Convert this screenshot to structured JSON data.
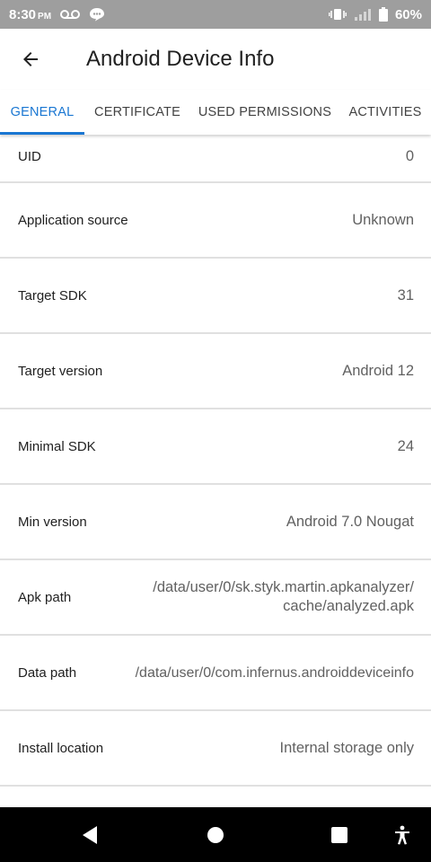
{
  "status_bar": {
    "time": "8:30",
    "ampm": "PM",
    "battery": "60%",
    "icons": [
      "voicemail-icon",
      "message-icon",
      "vibrate-icon",
      "signal-icon",
      "battery-icon"
    ]
  },
  "app_bar": {
    "title": "Android Device Info",
    "back_icon": "arrow-back-icon"
  },
  "tabs": [
    {
      "label": "GENERAL",
      "active": true
    },
    {
      "label": "CERTIFICATE",
      "active": false
    },
    {
      "label": "USED PERMISSIONS",
      "active": false
    },
    {
      "label": "ACTIVITIES",
      "active": false
    }
  ],
  "rows": [
    {
      "label": "UID",
      "value": "0"
    },
    {
      "label": "Application source",
      "value": "Unknown"
    },
    {
      "label": "Target SDK",
      "value": "31"
    },
    {
      "label": "Target version",
      "value": "Android 12"
    },
    {
      "label": "Minimal SDK",
      "value": "24"
    },
    {
      "label": "Min version",
      "value": "Android 7.0 Nougat"
    },
    {
      "label": "Apk path",
      "value_line1": "/data/user/0/sk.styk.martin.apkanalyzer/",
      "value_line2": "cache/analyzed.apk"
    },
    {
      "label": "Data path",
      "value": "/data/user/0/com.infernus.androiddeviceinfo"
    },
    {
      "label": "Install location",
      "value": "Internal storage only"
    },
    {
      "label": "",
      "value": ""
    }
  ],
  "colors": {
    "accent": "#1976d2",
    "status_bar": "#9e9e9e",
    "divider": "#e0e0e0",
    "value_text": "#616161"
  },
  "nav_bar": {
    "buttons": [
      "back-triangle-icon",
      "home-circle-icon",
      "recents-square-icon",
      "accessibility-icon"
    ]
  }
}
